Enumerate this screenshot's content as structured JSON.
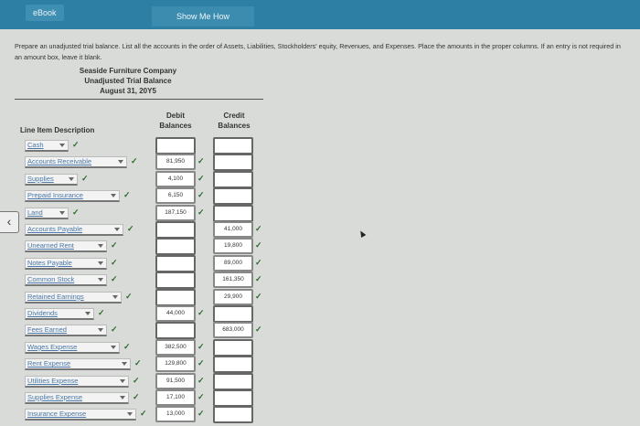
{
  "header": {
    "ebook_label": "eBook",
    "show_me_how_label": "Show Me How"
  },
  "instructions": "Prepare an unadjusted trial balance. List all the accounts in the order of Assets, Liabilities, Stockholders' equity, Revenues, and Expenses. Place the amounts in the proper columns. If an entry is not required in an amount box, leave it blank.",
  "report": {
    "company": "Seaside Furniture Company",
    "title": "Unadjusted Trial Balance",
    "date": "August 31, 20Y5"
  },
  "columns": {
    "description": "Line Item Description",
    "debit_1": "Debit",
    "debit_2": "Balances",
    "credit_1": "Credit",
    "credit_2": "Balances"
  },
  "rows": [
    {
      "account": "Cash",
      "debit": "",
      "credit": ""
    },
    {
      "account": "Accounts Receivable",
      "debit": "81,950",
      "credit": ""
    },
    {
      "account": "Supplies",
      "debit": "4,100",
      "credit": ""
    },
    {
      "account": "Prepaid Insurance",
      "debit": "6,150",
      "credit": ""
    },
    {
      "account": "Land",
      "debit": "187,150",
      "credit": ""
    },
    {
      "account": "Accounts Payable",
      "debit": "",
      "credit": "41,000"
    },
    {
      "account": "Unearned Rent",
      "debit": "",
      "credit": "19,800"
    },
    {
      "account": "Notes Payable",
      "debit": "",
      "credit": "89,000"
    },
    {
      "account": "Common Stock",
      "debit": "",
      "credit": "161,350"
    },
    {
      "account": "Retained Earnings",
      "debit": "",
      "credit": "29,900"
    },
    {
      "account": "Dividends",
      "debit": "44,000",
      "credit": ""
    },
    {
      "account": "Fees Earned",
      "debit": "",
      "credit": "683,000"
    },
    {
      "account": "Wages Expense",
      "debit": "382,500",
      "credit": ""
    },
    {
      "account": "Rent Expense",
      "debit": "129,800",
      "credit": ""
    },
    {
      "account": "Utilities Expense",
      "debit": "91,500",
      "credit": ""
    },
    {
      "account": "Supplies Expense",
      "debit": "17,100",
      "credit": ""
    },
    {
      "account": "Insurance Expense",
      "debit": "13,000",
      "credit": ""
    }
  ],
  "check_glyph": "✓",
  "nav": {
    "prev_glyph": "‹"
  },
  "colors": {
    "topbar": "#2d7fa3",
    "link": "#4b78a8",
    "check": "#2d6a2d"
  }
}
